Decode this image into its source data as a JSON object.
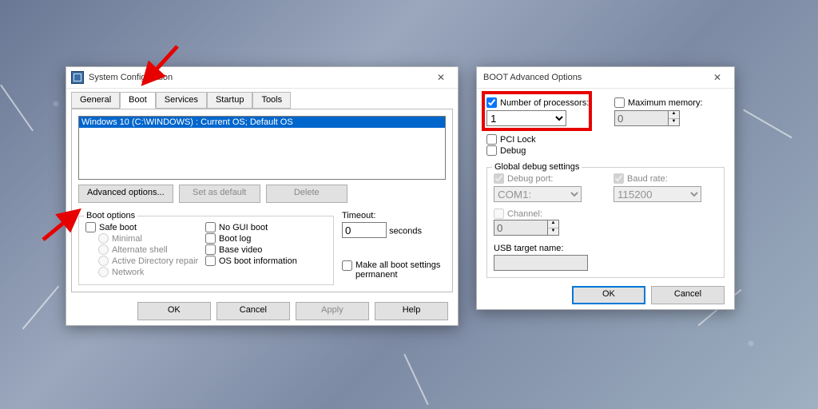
{
  "sysconfig": {
    "title": "System Configuration",
    "tabs": [
      "General",
      "Boot",
      "Services",
      "Startup",
      "Tools"
    ],
    "active_tab": 1,
    "os_entry": "Windows 10 (C:\\WINDOWS) : Current OS; Default OS",
    "buttons": {
      "advanced": "Advanced options...",
      "set_default": "Set as default",
      "delete": "Delete"
    },
    "group_label": "Boot options",
    "safe_boot": "Safe boot",
    "minimal": "Minimal",
    "alt_shell": "Alternate shell",
    "ad_repair": "Active Directory repair",
    "network": "Network",
    "no_gui": "No GUI boot",
    "boot_log": "Boot log",
    "base_video": "Base video",
    "os_info": "OS boot information",
    "timeout_label": "Timeout:",
    "timeout_value": "0",
    "timeout_unit": "seconds",
    "permanent": "Make all boot settings permanent",
    "ok": "OK",
    "cancel": "Cancel",
    "apply": "Apply",
    "help": "Help"
  },
  "bootadv": {
    "title": "BOOT Advanced Options",
    "num_proc_label": "Number of processors:",
    "num_proc_value": "1",
    "max_mem_label": "Maximum memory:",
    "max_mem_value": "0",
    "pci_lock": "PCI Lock",
    "debug": "Debug",
    "global_debug": "Global debug settings",
    "debug_port_label": "Debug port:",
    "debug_port_value": "COM1:",
    "baud_label": "Baud rate:",
    "baud_value": "115200",
    "channel_label": "Channel:",
    "channel_value": "0",
    "usb_target": "USB target name:",
    "ok": "OK",
    "cancel": "Cancel"
  }
}
